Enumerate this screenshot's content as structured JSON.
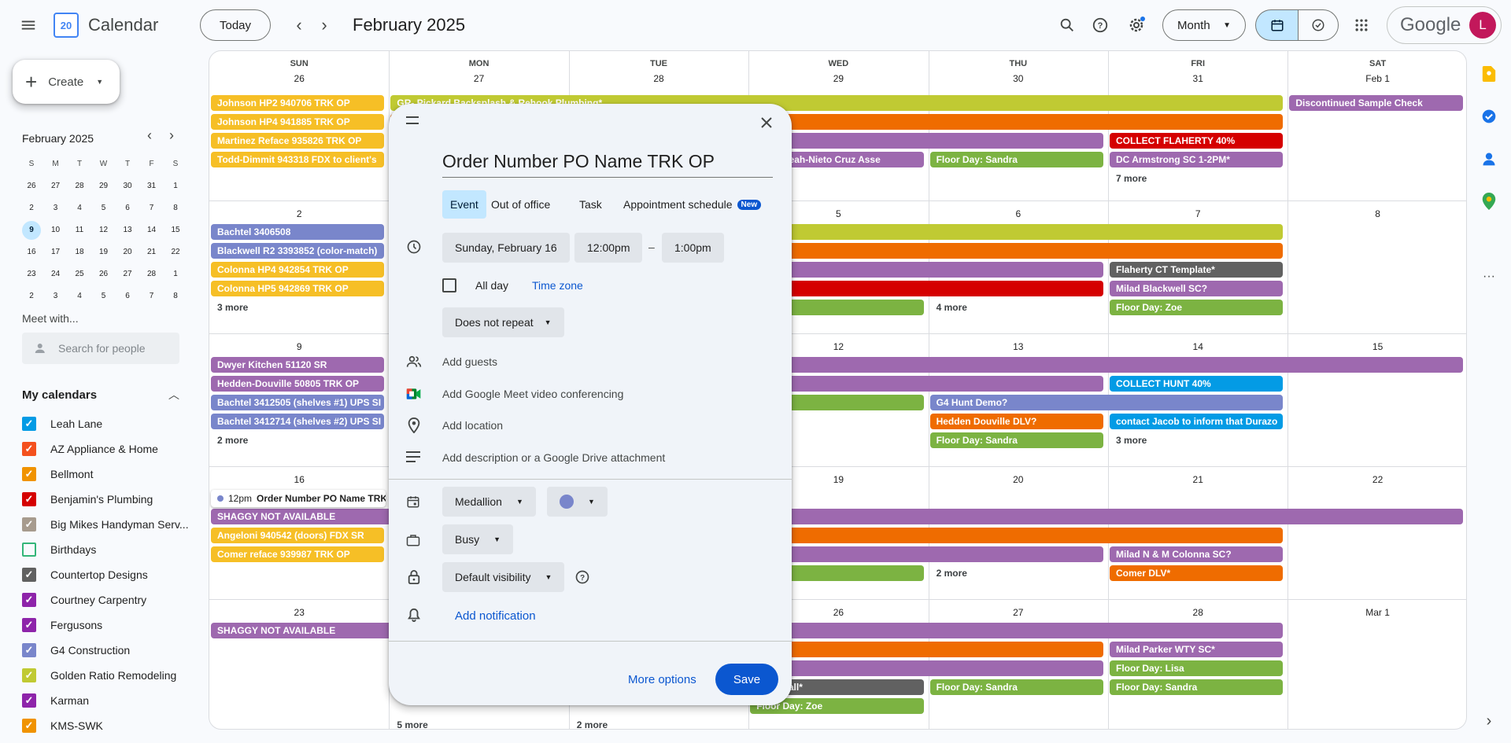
{
  "app": {
    "title": "Calendar",
    "logo_day": "20"
  },
  "toolbar": {
    "today": "Today",
    "period": "February 2025",
    "view": "Month",
    "google": "Google",
    "avatar": "L"
  },
  "sidebar": {
    "create": "Create",
    "mini_month": "February 2025",
    "weekdays": [
      "S",
      "M",
      "T",
      "W",
      "T",
      "F",
      "S"
    ],
    "weeks": [
      [
        "26",
        "27",
        "28",
        "29",
        "30",
        "31",
        "1"
      ],
      [
        "2",
        "3",
        "4",
        "5",
        "6",
        "7",
        "8"
      ],
      [
        "9",
        "10",
        "11",
        "12",
        "13",
        "14",
        "15"
      ],
      [
        "16",
        "17",
        "18",
        "19",
        "20",
        "21",
        "22"
      ],
      [
        "23",
        "24",
        "25",
        "26",
        "27",
        "28",
        "1"
      ],
      [
        "2",
        "3",
        "4",
        "5",
        "6",
        "7",
        "8"
      ]
    ],
    "today": "9",
    "meet_with": "Meet with...",
    "search_people_placeholder": "Search for people",
    "my_calendars": "My calendars",
    "calendars": [
      {
        "name": "Leah Lane",
        "color": "#039be5",
        "checked": true
      },
      {
        "name": "AZ Appliance & Home",
        "color": "#f4511e",
        "checked": true
      },
      {
        "name": "Bellmont",
        "color": "#f09300",
        "checked": true
      },
      {
        "name": "Benjamin's Plumbing",
        "color": "#d50000",
        "checked": true
      },
      {
        "name": "Big Mikes Handyman Serv...",
        "color": "#a79b8e",
        "checked": true
      },
      {
        "name": "Birthdays",
        "color": "#33b679",
        "checked": false
      },
      {
        "name": "Countertop Designs",
        "color": "#616161",
        "checked": true
      },
      {
        "name": "Courtney Carpentry",
        "color": "#8e24aa",
        "checked": true
      },
      {
        "name": "Fergusons",
        "color": "#8e24aa",
        "checked": true
      },
      {
        "name": "G4 Construction",
        "color": "#7986cb",
        "checked": true
      },
      {
        "name": "Golden Ratio Remodeling",
        "color": "#c0ca33",
        "checked": true
      },
      {
        "name": "Karman",
        "color": "#8e24aa",
        "checked": true
      },
      {
        "name": "KMS-SWK",
        "color": "#f09300",
        "checked": true
      }
    ]
  },
  "grid": {
    "headers": [
      "SUN",
      "MON",
      "TUE",
      "WED",
      "THU",
      "FRI",
      "SAT"
    ],
    "rows": [
      [
        "26",
        "27",
        "28",
        "29",
        "30",
        "31",
        "Feb 1"
      ],
      [
        "2",
        "",
        "",
        "5",
        "6",
        "7",
        "8"
      ],
      [
        "9",
        "",
        "",
        "12",
        "13",
        "14",
        "15"
      ],
      [
        "16",
        "",
        "",
        "19",
        "20",
        "21",
        "22"
      ],
      [
        "23",
        "",
        "",
        "26",
        "27",
        "28",
        "Mar 1"
      ]
    ]
  },
  "events": [
    {
      "t": "Johnson HP2 940706 TRK OP",
      "c": "#f6bf26",
      "col": 0,
      "span": 1,
      "row": 0,
      "slot": 0
    },
    {
      "t": "Johnson HP4 941885 TRK OP",
      "c": "#f6bf26",
      "col": 0,
      "span": 1,
      "row": 0,
      "slot": 1
    },
    {
      "t": "Martinez Reface 935826 TRK OP",
      "c": "#f6bf26",
      "col": 0,
      "span": 1,
      "row": 0,
      "slot": 2
    },
    {
      "t": "Todd-Dimmit 943318 FDX to client's",
      "c": "#f6bf26",
      "col": 0,
      "span": 1,
      "row": 0,
      "slot": 3
    },
    {
      "t": "GR- Pickard Backsplash & Rehook Plumbing*",
      "c": "#c0ca33",
      "col": 1,
      "span": 5,
      "row": 0,
      "slot": 0
    },
    {
      "t": "",
      "c": "#ef6c00",
      "col": 1,
      "span": 5,
      "row": 0,
      "slot": 1
    },
    {
      "t": "",
      "c": "#9e69af",
      "col": 1,
      "span": 4,
      "row": 0,
      "slot": 2
    },
    {
      "t": "COLLECT FLAHERTY 40%",
      "c": "#d50000",
      "col": 5,
      "span": 1,
      "row": 0,
      "slot": 2
    },
    {
      "t": "red & Leah-Nieto Cruz Asse",
      "c": "#9e69af",
      "col": 3,
      "span": 1,
      "row": 0,
      "slot": 3
    },
    {
      "t": "Floor Day: Sandra",
      "c": "#7cb342",
      "col": 4,
      "span": 1,
      "row": 0,
      "slot": 3
    },
    {
      "t": "DC Armstrong SC 1-2PM*",
      "c": "#9e69af",
      "col": 5,
      "span": 1,
      "row": 0,
      "slot": 3
    },
    {
      "t": "Discontinued Sample Check",
      "c": "#9e69af",
      "col": 6,
      "span": 1,
      "row": 0,
      "slot": 0
    },
    {
      "t": "Bachtel 3406508",
      "c": "#7986cb",
      "col": 0,
      "span": 1,
      "row": 1,
      "slot": 0
    },
    {
      "t": "Blackwell R2 3393852 (color-match)",
      "c": "#7986cb",
      "col": 0,
      "span": 1,
      "row": 1,
      "slot": 1
    },
    {
      "t": "Colonna HP4 942854 TRK OP",
      "c": "#f6bf26",
      "col": 0,
      "span": 1,
      "row": 1,
      "slot": 2
    },
    {
      "t": "Colonna HP5 942869 TRK OP",
      "c": "#f6bf26",
      "col": 0,
      "span": 1,
      "row": 1,
      "slot": 3
    },
    {
      "t": "",
      "c": "#c0ca33",
      "col": 1,
      "span": 5,
      "row": 1,
      "slot": 0
    },
    {
      "t": "",
      "c": "#ef6c00",
      "col": 1,
      "span": 5,
      "row": 1,
      "slot": 1
    },
    {
      "t": "",
      "c": "#9e69af",
      "col": 1,
      "span": 4,
      "row": 1,
      "slot": 2
    },
    {
      "t": "Flaherty CT Template*",
      "c": "#616161",
      "col": 5,
      "span": 1,
      "row": 1,
      "slot": 2
    },
    {
      "t": "",
      "c": "#d50000",
      "col": 1,
      "span": 4,
      "row": 1,
      "slot": 3
    },
    {
      "t": "Milad Blackwell SC?",
      "c": "#9e69af",
      "col": 5,
      "span": 1,
      "row": 1,
      "slot": 3
    },
    {
      "t": "y: Zoe",
      "c": "#7cb342",
      "col": 3,
      "span": 1,
      "row": 1,
      "slot": 4
    },
    {
      "t": "Floor Day: Zoe",
      "c": "#7cb342",
      "col": 5,
      "span": 1,
      "row": 1,
      "slot": 4
    },
    {
      "t": "Dwyer Kitchen 51120 SR",
      "c": "#9e69af",
      "col": 0,
      "span": 1,
      "row": 2,
      "slot": 0
    },
    {
      "t": "Hedden-Douville 50805 TRK OP",
      "c": "#9e69af",
      "col": 0,
      "span": 1,
      "row": 2,
      "slot": 1
    },
    {
      "t": "Bachtel 3412505 (shelves #1) UPS SI",
      "c": "#7986cb",
      "col": 0,
      "span": 1,
      "row": 2,
      "slot": 2
    },
    {
      "t": "Bachtel 3412714 (shelves #2) UPS SI",
      "c": "#7986cb",
      "col": 0,
      "span": 1,
      "row": 2,
      "slot": 3
    },
    {
      "t": "",
      "c": "#9e69af",
      "col": 1,
      "span": 6,
      "row": 2,
      "slot": 0
    },
    {
      "t": "",
      "c": "#9e69af",
      "col": 1,
      "span": 4,
      "row": 2,
      "slot": 1
    },
    {
      "t": "COLLECT HUNT 40%",
      "c": "#039be5",
      "col": 5,
      "span": 1,
      "row": 2,
      "slot": 1
    },
    {
      "t": "y: Zoe",
      "c": "#7cb342",
      "col": 3,
      "span": 1,
      "row": 2,
      "slot": 2
    },
    {
      "t": "G4 Hunt Demo?",
      "c": "#7986cb",
      "col": 4,
      "span": 2,
      "row": 2,
      "slot": 2
    },
    {
      "t": "Hedden Douville DLV?",
      "c": "#ef6c00",
      "col": 4,
      "span": 1,
      "row": 2,
      "slot": 3
    },
    {
      "t": "contact Jacob to inform that Durazo",
      "c": "#039be5",
      "col": 5,
      "span": 1,
      "row": 2,
      "slot": 3
    },
    {
      "t": "Floor Day: Sandra",
      "c": "#7cb342",
      "col": 4,
      "span": 1,
      "row": 2,
      "slot": 4
    },
    {
      "t": "SHAGGY NOT AVAILABLE",
      "c": "#9e69af",
      "col": 0,
      "span": 7,
      "row": 3,
      "slot": 1
    },
    {
      "t": "Angeloni 940542 (doors) FDX SR",
      "c": "#f6bf26",
      "col": 0,
      "span": 1,
      "row": 3,
      "slot": 2
    },
    {
      "t": "",
      "c": "#ef6c00",
      "col": 1,
      "span": 5,
      "row": 3,
      "slot": 2
    },
    {
      "t": "Comer reface 939987 TRK OP",
      "c": "#f6bf26",
      "col": 0,
      "span": 1,
      "row": 3,
      "slot": 3
    },
    {
      "t": "",
      "c": "#9e69af",
      "col": 1,
      "span": 4,
      "row": 3,
      "slot": 3
    },
    {
      "t": "Milad N & M Colonna SC?",
      "c": "#9e69af",
      "col": 5,
      "span": 1,
      "row": 3,
      "slot": 3
    },
    {
      "t": "y: Zoe",
      "c": "#7cb342",
      "col": 3,
      "span": 1,
      "row": 3,
      "slot": 4
    },
    {
      "t": "Comer DLV*",
      "c": "#ef6c00",
      "col": 5,
      "span": 1,
      "row": 3,
      "slot": 4
    },
    {
      "t": "SHAGGY NOT AVAILABLE",
      "c": "#9e69af",
      "col": 0,
      "span": 6,
      "row": 4,
      "slot": 0
    },
    {
      "t": "",
      "c": "#ef6c00",
      "col": 1,
      "span": 4,
      "row": 4,
      "slot": 1
    },
    {
      "t": "Milad Parker WTY SC*",
      "c": "#9e69af",
      "col": 5,
      "span": 1,
      "row": 4,
      "slot": 1
    },
    {
      "t": "",
      "c": "#9e69af",
      "col": 1,
      "span": 4,
      "row": 4,
      "slot": 2
    },
    {
      "t": "Floor Day: Lisa",
      "c": "#7cb342",
      "col": 5,
      "span": 1,
      "row": 4,
      "slot": 2
    },
    {
      "t": "CT Install*",
      "c": "#616161",
      "col": 3,
      "span": 1,
      "row": 4,
      "slot": 3
    },
    {
      "t": "Floor Day: Sandra",
      "c": "#7cb342",
      "col": 4,
      "span": 1,
      "row": 4,
      "slot": 3
    },
    {
      "t": "Floor Day: Sandra",
      "c": "#7cb342",
      "col": 5,
      "span": 1,
      "row": 4,
      "slot": 3
    },
    {
      "t": "Floor Day: Zoe",
      "c": "#7cb342",
      "col": 3,
      "span": 1,
      "row": 4,
      "slot": 4
    }
  ],
  "more_links": [
    {
      "t": "7 more",
      "col": 5,
      "row": 0,
      "slot": 4
    },
    {
      "t": "3 more",
      "col": 0,
      "row": 1,
      "slot": 4
    },
    {
      "t": "4 more",
      "col": 4,
      "row": 1,
      "slot": 4
    },
    {
      "t": "2 more",
      "col": 0,
      "row": 2,
      "slot": 4
    },
    {
      "t": "3 more",
      "col": 5,
      "row": 2,
      "slot": 4
    },
    {
      "t": "2 more",
      "col": 4,
      "row": 3,
      "slot": 4
    },
    {
      "t": "5 more",
      "col": 1,
      "row": 4,
      "slot": 5
    },
    {
      "t": "2 more",
      "col": 2,
      "row": 4,
      "slot": 5
    }
  ],
  "draft_chip": {
    "time": "12pm",
    "title": "Order Number PO Name TRK"
  },
  "dialog": {
    "title": "Order Number PO Name TRK OP",
    "tabs": [
      "Event",
      "Out of office",
      "Task",
      "Appointment schedule"
    ],
    "new_badge": "New",
    "date": "Sunday, February 16",
    "start": "12:00pm",
    "dash": "–",
    "end": "1:00pm",
    "all_day": "All day",
    "time_zone": "Time zone",
    "repeat": "Does not repeat",
    "add_guests": "Add guests",
    "meet": "Add Google Meet video conferencing",
    "location": "Add location",
    "description": "Add description or a Google Drive attachment",
    "calendar": "Medallion",
    "event_color": "#7986cb",
    "availability": "Busy",
    "visibility": "Default visibility",
    "notification": "Add notification",
    "more_options": "More options",
    "save": "Save"
  }
}
